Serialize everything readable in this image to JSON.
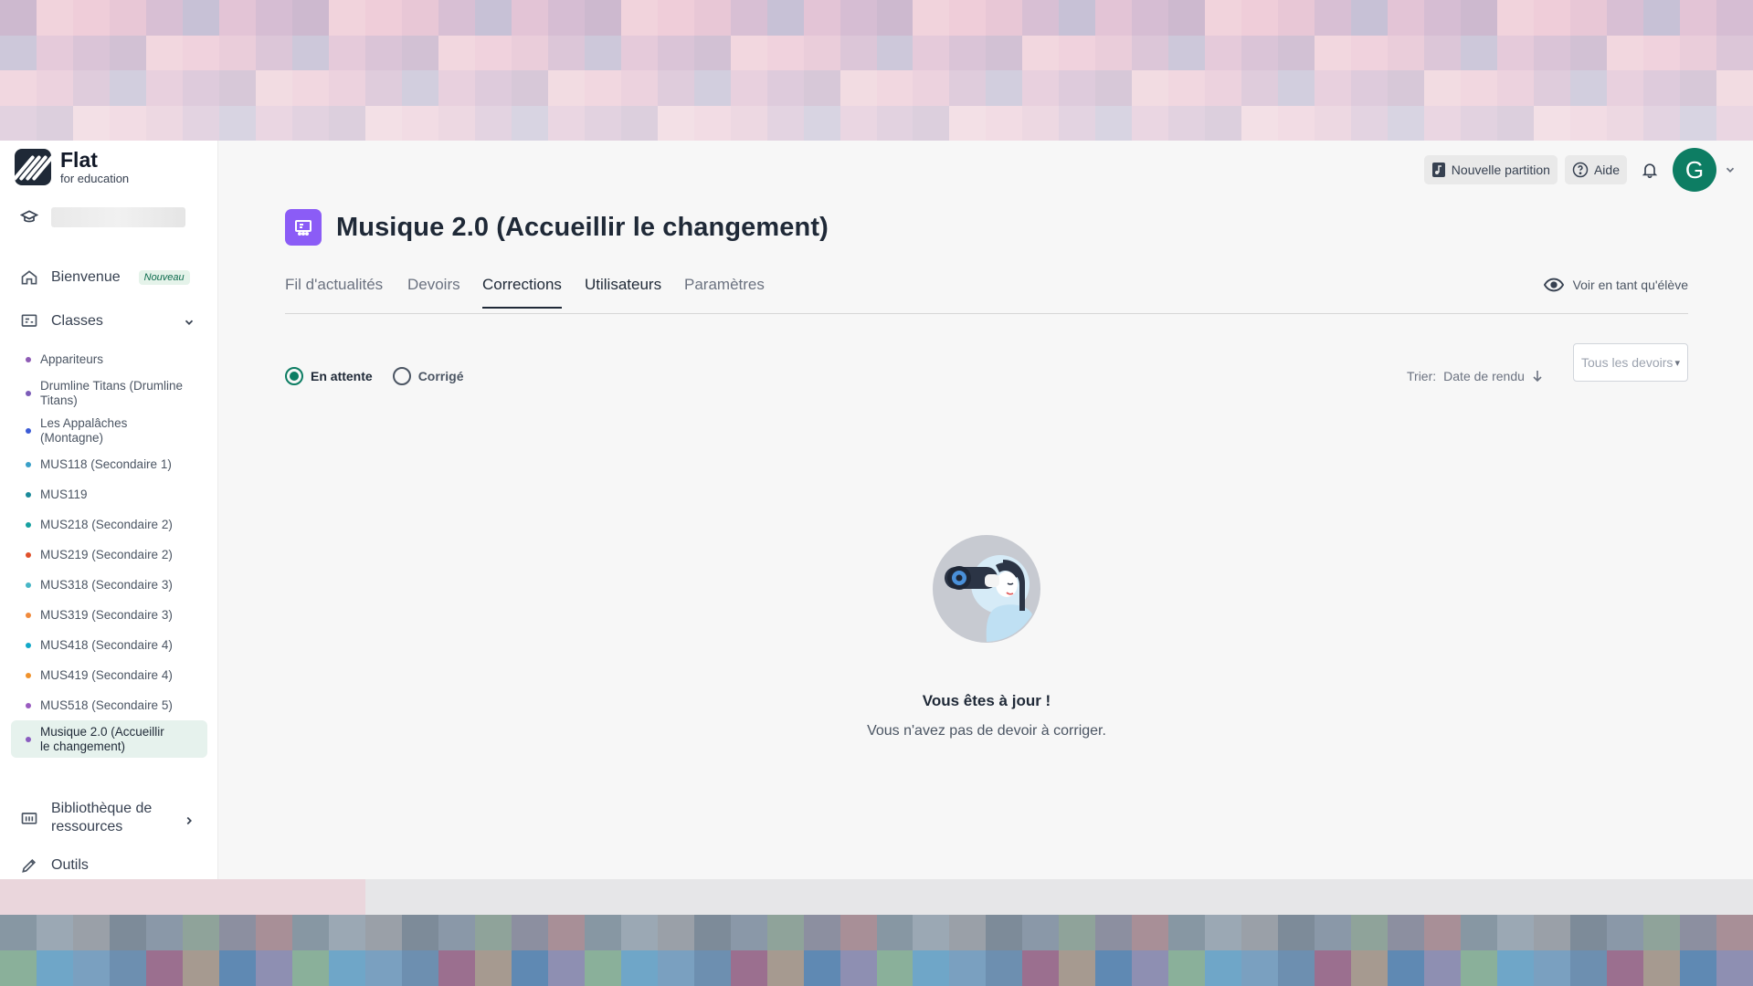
{
  "colors": {
    "accent": "#0d7d63",
    "class_icon": "#8b5cf6",
    "active_nav_bg": "#e6f2ed"
  },
  "logo": {
    "name": "Flat",
    "sub": "for education"
  },
  "sidebar": {
    "welcome_label": "Bienvenue",
    "welcome_badge": "Nouveau",
    "classes_label": "Classes",
    "classes": [
      {
        "label": "Appariteurs",
        "color": "#8e5bb5"
      },
      {
        "label": "Drumline Titans (Drumline Titans)",
        "color": "#7c5cb8"
      },
      {
        "label": "Les Appalâches (Montagne)",
        "color": "#3b5bd6"
      },
      {
        "label": "MUS118 (Secondaire 1)",
        "color": "#3aa0c8"
      },
      {
        "label": "MUS119",
        "color": "#1a8a9a"
      },
      {
        "label": "MUS218 (Secondaire 2)",
        "color": "#16a0a0"
      },
      {
        "label": "MUS219 (Secondaire 2)",
        "color": "#e0502a"
      },
      {
        "label": "MUS318 (Secondaire 3)",
        "color": "#47b6c6"
      },
      {
        "label": "MUS319 (Secondaire 3)",
        "color": "#f08a3c"
      },
      {
        "label": "MUS418 (Secondaire 4)",
        "color": "#12a8c8"
      },
      {
        "label": "MUS419 (Secondaire 4)",
        "color": "#f0922c"
      },
      {
        "label": "MUS518 (Secondaire 5)",
        "color": "#9a5cc0"
      },
      {
        "label": "Musique 2.0 (Accueillir le changement)",
        "color": "#8a5cc0"
      }
    ],
    "library_label": "Bibliothèque de ressources",
    "tools_label": "Outils"
  },
  "header": {
    "new_score_label": "Nouvelle partition",
    "help_label": "Aide",
    "avatar_initial": "G"
  },
  "main": {
    "title": "Musique 2.0 (Accueillir le changement)",
    "tabs": [
      {
        "label": "Fil d'actualités"
      },
      {
        "label": "Devoirs"
      },
      {
        "label": "Corrections"
      },
      {
        "label": "Utilisateurs"
      },
      {
        "label": "Paramètres"
      }
    ],
    "view_as_student": "Voir en tant qu'élève",
    "filter_pending": "En attente",
    "filter_corrected": "Corrigé",
    "sort_label": "Trier:",
    "sort_value": "Date de rendu",
    "assignment_select": "Tous les devoirs",
    "empty_title": "Vous êtes à jour !",
    "empty_text": "Vous n'avez pas de devoir à corriger."
  }
}
